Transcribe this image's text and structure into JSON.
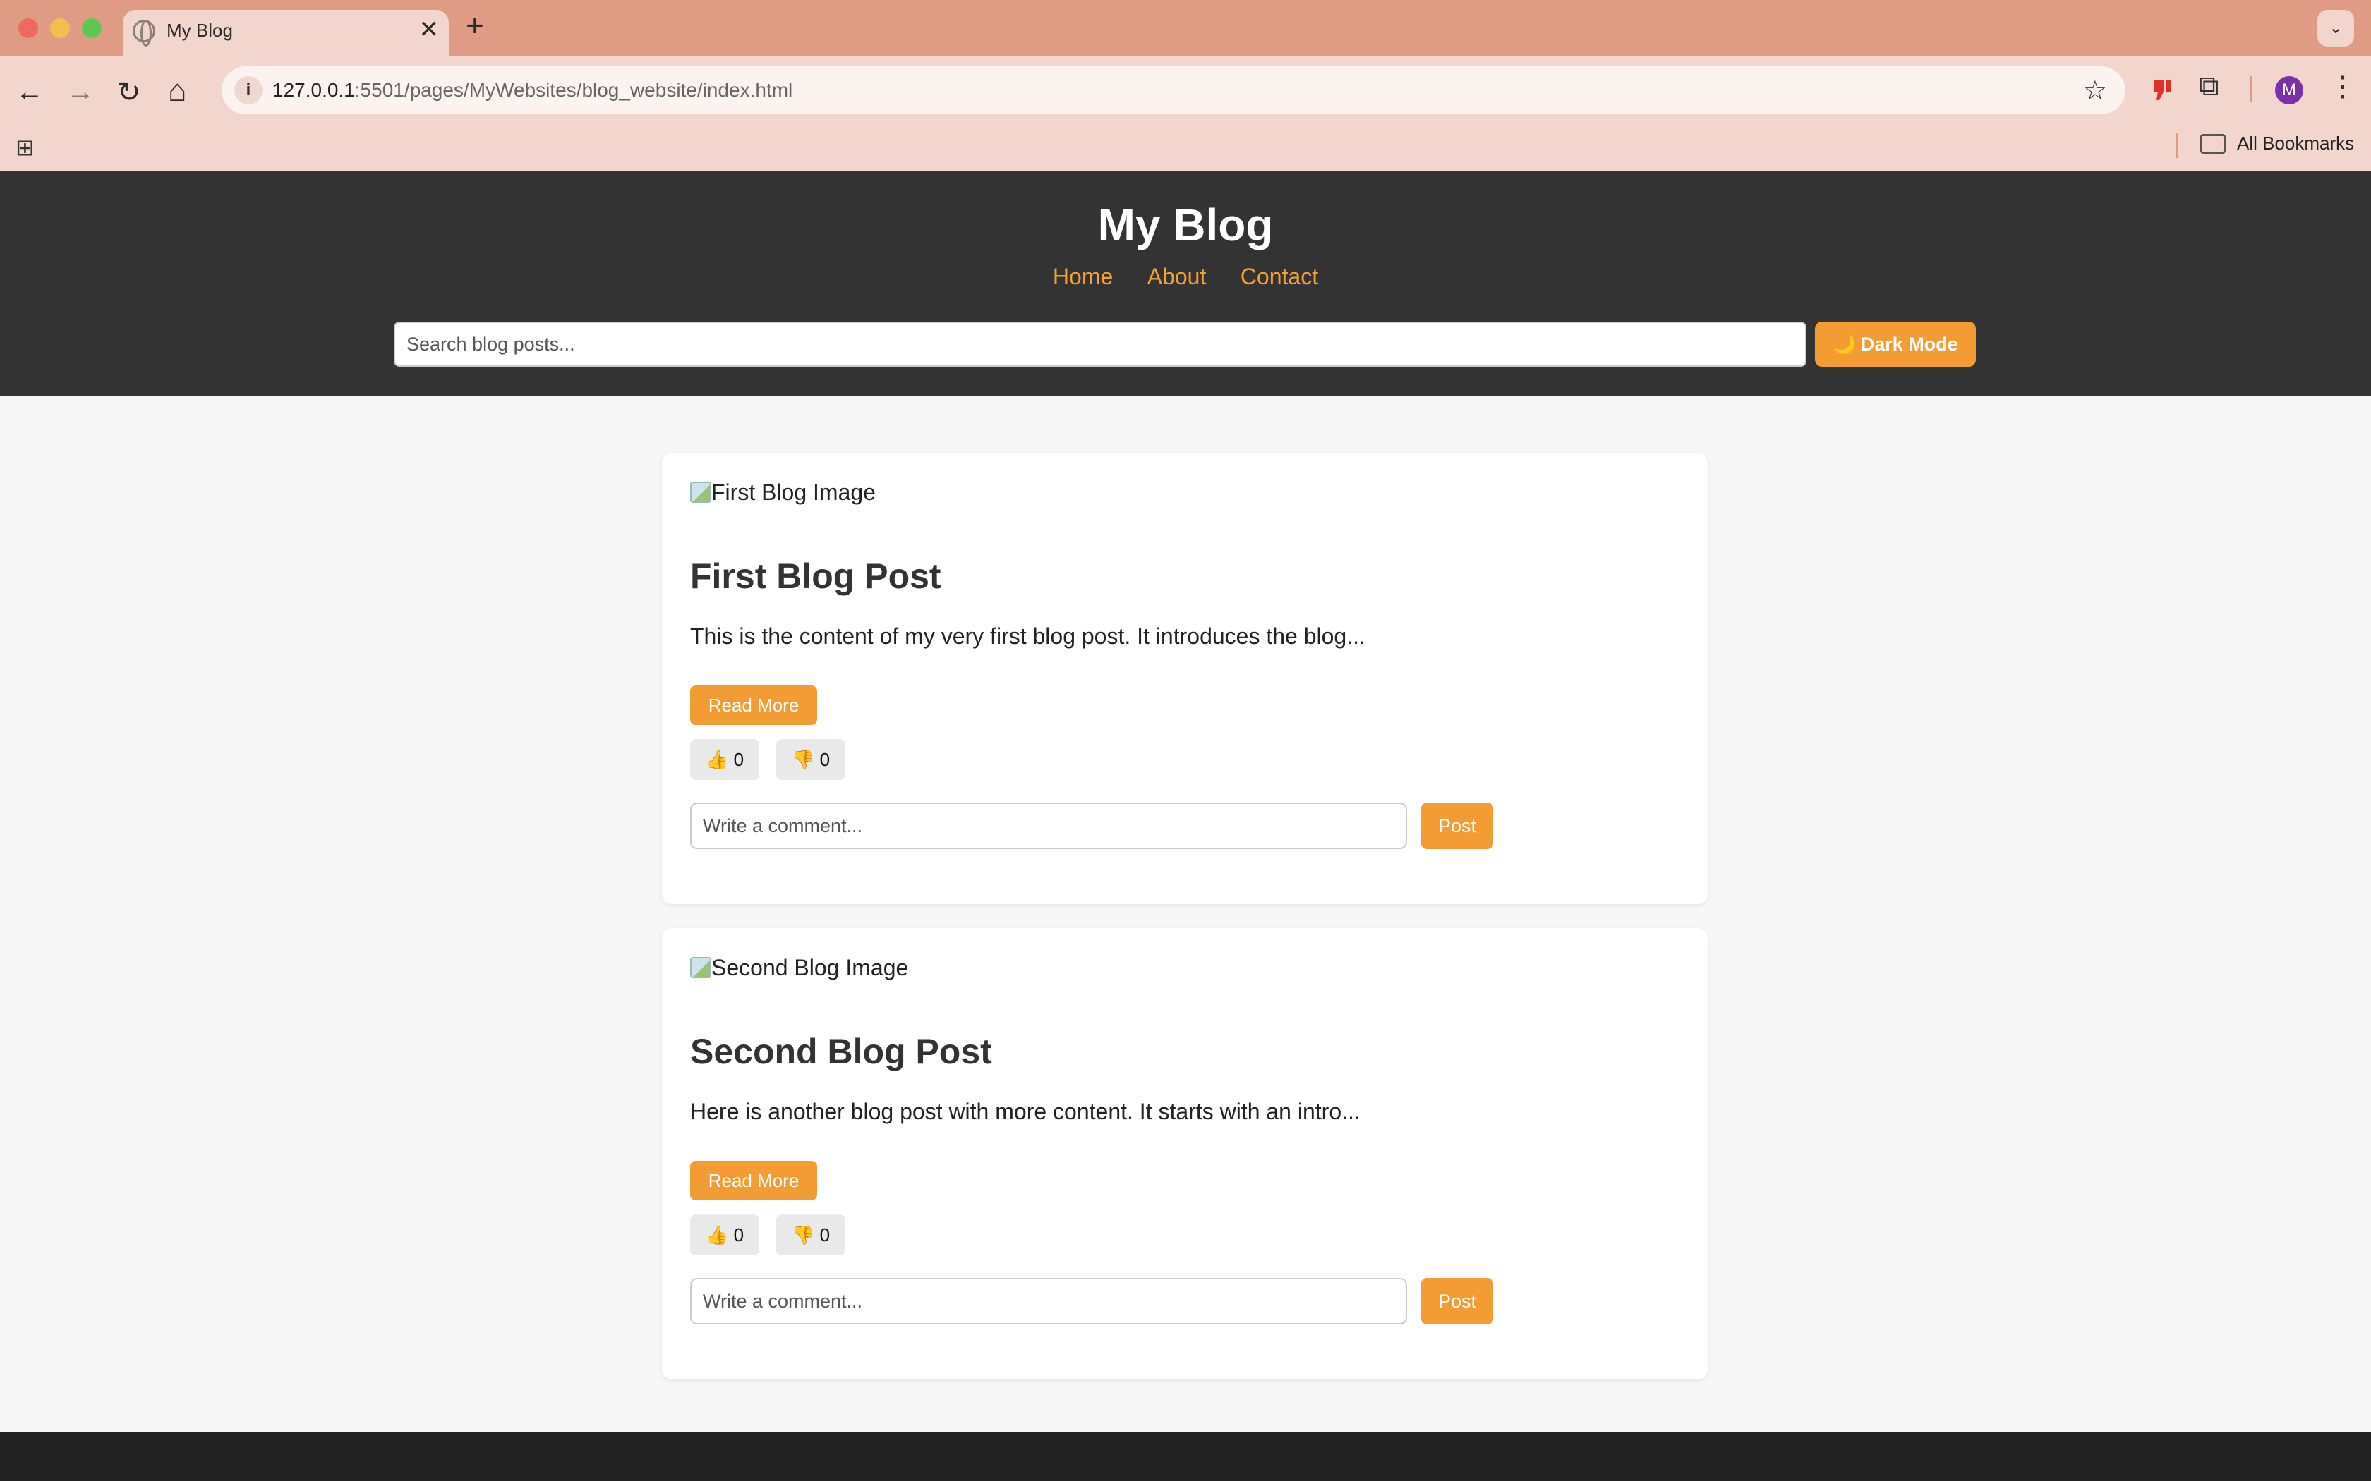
{
  "browser": {
    "tab_title": "My Blog",
    "tab_close": "✕",
    "new_tab": "+",
    "tab_menu": "⌄",
    "url_host": "127.0.0.1",
    "url_rest": ":5501/pages/MyWebsites/blog_website/index.html",
    "bookmarks_label": "All Bookmarks",
    "profile_initial": "M",
    "icons": {
      "back": "←",
      "forward": "→",
      "reload": "↻",
      "home": "⌂",
      "info": "i",
      "star": "☆",
      "apps": "⊞",
      "menu": "⋮",
      "extensions": "⧉"
    }
  },
  "header": {
    "title": "My Blog",
    "nav": [
      "Home",
      "About",
      "Contact"
    ],
    "search_placeholder": "Search blog posts...",
    "dark_mode_icon": "🌙",
    "dark_mode_label": "Dark Mode"
  },
  "posts": [
    {
      "image_alt": "First Blog Image",
      "title": "First Blog Post",
      "excerpt": "This is the content of my very first blog post. It introduces the blog...",
      "read_more": "Read More",
      "likes": "👍 0",
      "dislikes": "👎 0",
      "comment_placeholder": "Write a comment...",
      "post_label": "Post"
    },
    {
      "image_alt": "Second Blog Image",
      "title": "Second Blog Post",
      "excerpt": "Here is another blog post with more content. It starts with an intro...",
      "read_more": "Read More",
      "likes": "👍 0",
      "dislikes": "👎 0",
      "comment_placeholder": "Write a comment...",
      "post_label": "Post"
    }
  ],
  "colors": {
    "accent": "#f29c33",
    "header_bg": "#333333",
    "page_bg": "#f7f7f7",
    "chrome_tabbar": "#e09b85",
    "chrome_toolbar": "#f2d5cc"
  }
}
